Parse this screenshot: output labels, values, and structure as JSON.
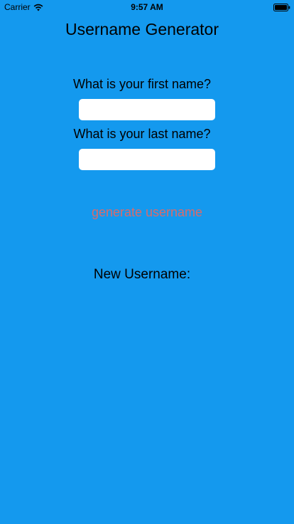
{
  "status_bar": {
    "carrier": "Carrier",
    "time": "9:57 AM",
    "wifi_icon": "wifi-icon",
    "battery_icon": "battery-icon"
  },
  "app": {
    "title": "Username Generator",
    "first_name_label": "What is your first name?",
    "first_name_value": "",
    "last_name_label": "What is your last name?",
    "last_name_value": "",
    "generate_button_label": "generate username",
    "new_username_label": "New Username:"
  },
  "colors": {
    "background": "#1499ee",
    "button_text": "#d96b6b",
    "field_background": "#ffffff"
  }
}
